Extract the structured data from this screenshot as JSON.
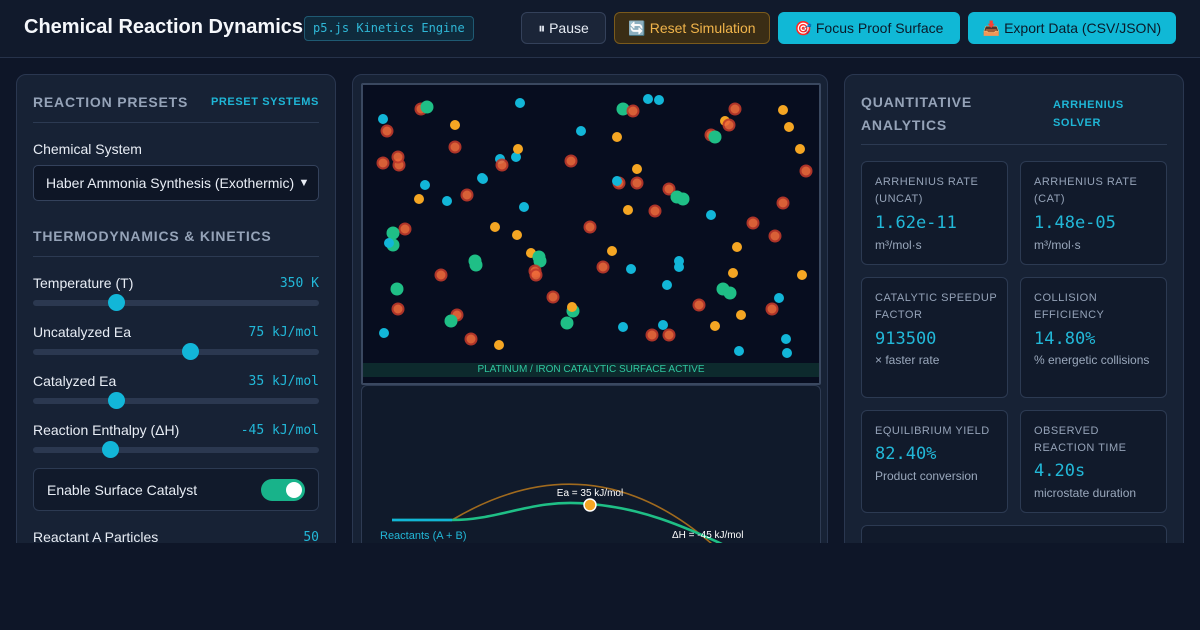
{
  "header": {
    "title": "Chemical Reaction Dynamics",
    "engine_badge": "p5.js Kinetics Engine",
    "pause_label": "⏸ Pause",
    "reset_label": "🔄 Reset Simulation",
    "focus_label": "🎯 Focus Proof Surface",
    "export_label": "📥 Export Data (CSV/JSON)"
  },
  "left": {
    "presets_title": "Reaction Presets",
    "presets_tag": "PRESET SYSTEMS",
    "system_label": "Chemical System",
    "system_value": "Haber Ammonia Synthesis (Exothermic)",
    "thermo_title": "Thermodynamics & Kinetics",
    "temperature": {
      "label": "Temperature (T)",
      "display": "350 K",
      "fraction": 0.29
    },
    "ea_uncat": {
      "label": "Uncatalyzed Ea",
      "display": "75 kJ/mol",
      "fraction": 0.55
    },
    "ea_cat": {
      "label": "Catalyzed Ea",
      "display": "35 kJ/mol",
      "fraction": 0.29
    },
    "enthalpy": {
      "label": "Reaction Enthalpy (ΔH)",
      "display": "-45 kJ/mol",
      "fraction": 0.27
    },
    "catalyst_label": "Enable Surface Catalyst",
    "catalyst_on": true,
    "reactant_a_label": "Reactant A Particles",
    "reactant_a_value": "50"
  },
  "center": {
    "surface_caption": "PLATINUM / IRON CATALYTIC SURFACE ACTIVE",
    "energy": {
      "ea_label": "Ea = 35 kJ/mol",
      "reactants_label": "Reactants (A + B)",
      "dh_label": "ΔH = -45 kJ/mol"
    },
    "colors": {
      "cyan": "#12b6d8",
      "orange": "#f5a623",
      "green": "#1fbf86",
      "red_ring": "#c0392b",
      "red_fill": "#ef6a3a"
    }
  },
  "right": {
    "title": "Quantitative Analytics",
    "tag_line1": "ARRHENIUS",
    "tag_line2": "SOLVER",
    "cards": [
      {
        "title": "Arrhenius Rate (Uncat)",
        "value": "1.62e-11",
        "sub": "m³/mol·s"
      },
      {
        "title": "Arrhenius Rate (Cat)",
        "value": "1.48e-05",
        "sub": "m³/mol·s"
      },
      {
        "title": "Catalytic Speedup Factor",
        "value": "913500",
        "sub": "× faster rate"
      },
      {
        "title": "Collision Efficiency",
        "value": "14.80%",
        "sub": "% energetic collisions"
      },
      {
        "title": "Equilibrium Yield",
        "value": "82.40%",
        "sub": "Product conversion"
      },
      {
        "title": "Observed Reaction Time",
        "value": "4.20s",
        "sub": "microstate duration"
      }
    ]
  }
}
